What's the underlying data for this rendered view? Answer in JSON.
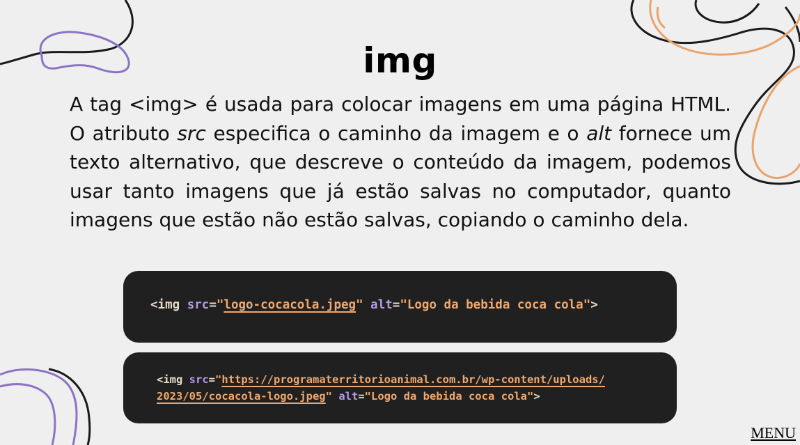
{
  "title": "img",
  "description": {
    "part1": "A tag <img> é usada para colocar imagens em uma página HTML. O atributo ",
    "em1": "src",
    "part2": " especifica o caminho da imagem e o ",
    "em2": "alt",
    "part3": " fornece um texto alternativo, que descreve o conteúdo da imagem, podemos usar tanto imagens que já estão salvas no computador, quanto imagens que estão não estão salvas, copiando o caminho dela."
  },
  "code1": {
    "tag_open": "<img",
    "attr_src": "src",
    "eq": "=",
    "quote": "\"",
    "src_value": "logo-cocacola.jpeg",
    "attr_alt": "alt",
    "alt_value": "\"Logo da bebida coca cola\"",
    "tag_close": ">"
  },
  "code2": {
    "tag_open": "<img",
    "attr_src": "src",
    "eq": "=",
    "quote": "\"",
    "src_value_line1": "https://programaterritorioanimal.com.br/wp-content/uploads/",
    "src_value_line2": "2023/05/cocacola-logo.jpeg",
    "attr_alt": "alt",
    "alt_value": "\"Logo da bebida coca cola\"",
    "tag_close": ">"
  },
  "menu_label": "MENU",
  "colors": {
    "background": "#efefef",
    "code_bg": "#202020",
    "string": "#f2a86c",
    "attribute": "#b29ae6",
    "decor_orange": "#e9a36c",
    "decor_purple": "#8b74c4",
    "decor_black": "#1a1a1a"
  }
}
